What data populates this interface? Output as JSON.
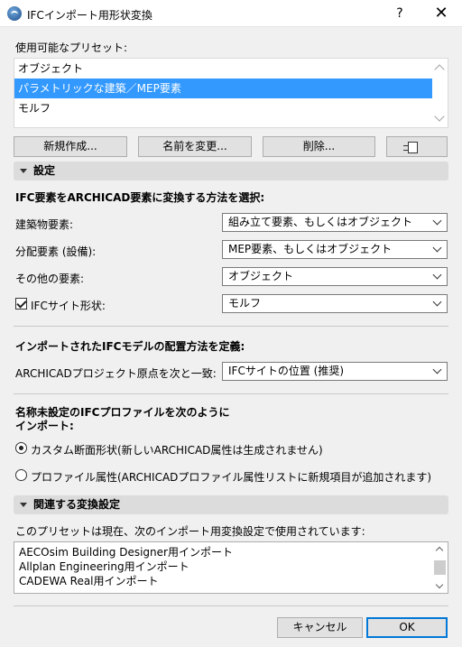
{
  "window": {
    "title": "IFCインポート用形状変換",
    "help_label": "?",
    "close_label": "✕"
  },
  "presets": {
    "label": "使用可能なプリセット:",
    "items": [
      {
        "label": "オブジェクト"
      },
      {
        "label": "パラメトリックな建築／MEP要素",
        "selected": true
      },
      {
        "label": "モルフ"
      }
    ],
    "buttons": {
      "new": "新規作成...",
      "rename": "名前を変更...",
      "delete": "削除...",
      "export_icon": "document-export-icon"
    }
  },
  "settings": {
    "header": "設定",
    "convert_heading": "IFC要素をARCHICAD要素に変換する方法を選択:",
    "rows": [
      {
        "label": "建築物要素:",
        "value": "組み立て要素、もしくはオブジェクト"
      },
      {
        "label": "分配要素 (設備):",
        "value": "MEP要素、もしくはオブジェクト"
      },
      {
        "label": "その他の要素:",
        "value": "オブジェクト"
      },
      {
        "label": "IFCサイト形状:",
        "value": "モルフ",
        "checked": true
      }
    ],
    "placement_heading": "インポートされたIFCモデルの配置方法を定義:",
    "origin_label": "ARCHICADプロジェクト原点を次と一致:",
    "origin_value": "IFCサイトの位置 (推奨)",
    "profile_heading_line1": "名称未設定のIFCプロファイルを次のように",
    "profile_heading_line2": "インポート:",
    "radio_custom": "カスタム断面形状(新しいARCHICAD属性は生成されません)",
    "radio_profile": "プロファイル属性(ARCHICADプロファイル属性リストに新規項目が追加されます)",
    "selected_radio": "custom"
  },
  "related": {
    "header": "関連する変換設定",
    "description": "このプリセットは現在、次のインポート用変換設定で使用されています:",
    "items": [
      "AECOsim Building Designer用インポート",
      "Allplan Engineering用インポート",
      "CADEWA Real用インポート"
    ]
  },
  "footer": {
    "cancel": "キャンセル",
    "ok": "OK"
  },
  "colors": {
    "selection": "#3399ff",
    "accent_border": "#0078d7"
  }
}
